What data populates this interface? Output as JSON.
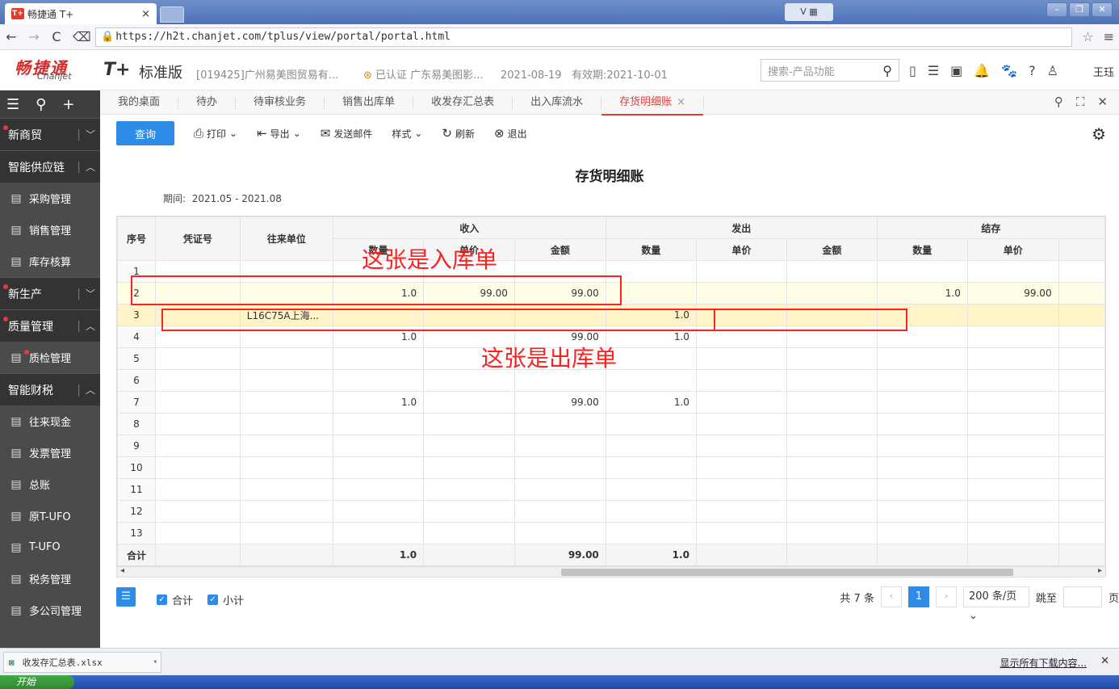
{
  "browser": {
    "tab_title": "畅捷通 T+",
    "tab_logo": "T+",
    "tab_close": "×",
    "url": "https://h2t.chanjet.com/tplus/view/portal/portal.html",
    "win_buttons": [
      "–",
      "❐",
      "✕"
    ]
  },
  "header": {
    "logo_cn": "畅捷通",
    "logo_en": "Chanjet",
    "product": "T+",
    "edition": "标准版",
    "company": "[019425]广州易美图贸易有...",
    "certified": "已认证 广东易美图影...",
    "date": "2021-08-19",
    "validity": "有效期:2021-10-01",
    "search_placeholder": "搜索-产品功能",
    "username": "王珏"
  },
  "sidebar": {
    "groups": [
      {
        "label": "新商贸",
        "arrow": "﹀",
        "dot": true,
        "items": []
      },
      {
        "label": "智能供应链",
        "arrow": "︿",
        "dot": false,
        "items": [
          {
            "label": "采购管理",
            "icon": "cart-icon"
          },
          {
            "label": "销售管理",
            "icon": "chart-icon"
          },
          {
            "label": "库存核算",
            "icon": "warehouse-icon"
          }
        ]
      },
      {
        "label": "新生产",
        "arrow": "﹀",
        "dot": true,
        "items": []
      },
      {
        "label": "质量管理",
        "arrow": "︿",
        "dot": true,
        "items": [
          {
            "label": "质检管理",
            "icon": "shield-icon",
            "dot": true
          }
        ]
      },
      {
        "label": "智能财税",
        "arrow": "︿",
        "dot": false,
        "items": [
          {
            "label": "往来现金",
            "icon": "exchange-icon"
          },
          {
            "label": "发票管理",
            "icon": "invoice-icon"
          },
          {
            "label": "总账",
            "icon": "ledger-icon"
          },
          {
            "label": "原T-UFO",
            "icon": "ufo-icon"
          },
          {
            "label": "T-UFO",
            "icon": "report-icon"
          },
          {
            "label": "税务管理",
            "icon": "tax-icon"
          },
          {
            "label": "多公司管理",
            "icon": "company-icon"
          }
        ]
      }
    ]
  },
  "tabs": {
    "items": [
      "我的桌面",
      "待办",
      "待审核业务",
      "销售出库单",
      "收发存汇总表",
      "出入库流水",
      "存货明细账"
    ],
    "active_index": 6,
    "close": "×"
  },
  "toolbar": {
    "query": "查询",
    "print": "打印",
    "export": "导出",
    "email": "发送邮件",
    "style": "样式",
    "refresh": "刷新",
    "exit": "退出"
  },
  "report": {
    "title": "存货明细账",
    "period_label": "期间:",
    "period_value": "2021.05 - 2021.08",
    "headers": {
      "seq": "序号",
      "voucher": "凭证号",
      "partner": "往来单位",
      "income": "收入",
      "outgo": "发出",
      "balance": "结存",
      "qty": "数量",
      "price": "单价",
      "amount": "金额"
    },
    "rows": [
      {
        "seq": "1",
        "partner": "",
        "in_qty": "",
        "in_price": "",
        "in_amt": "",
        "out_qty": "",
        "out_price": "",
        "out_amt": "",
        "bal_qty": "",
        "bal_price": "",
        "style": ""
      },
      {
        "seq": "2",
        "partner": "",
        "in_qty": "1.0",
        "in_price": "99.00",
        "in_amt": "99.00",
        "out_qty": "",
        "out_price": "",
        "out_amt": "",
        "bal_qty": "1.0",
        "bal_price": "99.00",
        "style": "hl"
      },
      {
        "seq": "3",
        "partner": "L16C75A上海...",
        "in_qty": "",
        "in_price": "",
        "in_amt": "",
        "out_qty": "1.0",
        "out_price": "",
        "out_amt": "",
        "bal_qty": "",
        "bal_price": "",
        "style": "hl2"
      },
      {
        "seq": "4",
        "partner": "",
        "in_qty": "1.0",
        "in_price": "",
        "in_amt": "99.00",
        "out_qty": "1.0",
        "out_price": "",
        "out_amt": "",
        "bal_qty": "",
        "bal_price": "",
        "style": ""
      },
      {
        "seq": "5",
        "partner": "",
        "in_qty": "",
        "in_price": "",
        "in_amt": "",
        "out_qty": "",
        "out_price": "",
        "out_amt": "",
        "bal_qty": "",
        "bal_price": "",
        "style": ""
      },
      {
        "seq": "6",
        "partner": "",
        "in_qty": "",
        "in_price": "",
        "in_amt": "",
        "out_qty": "",
        "out_price": "",
        "out_amt": "",
        "bal_qty": "",
        "bal_price": "",
        "style": ""
      },
      {
        "seq": "7",
        "partner": "",
        "in_qty": "1.0",
        "in_price": "",
        "in_amt": "99.00",
        "out_qty": "1.0",
        "out_price": "",
        "out_amt": "",
        "bal_qty": "",
        "bal_price": "",
        "style": ""
      },
      {
        "seq": "8",
        "partner": "",
        "in_qty": "",
        "in_price": "",
        "in_amt": "",
        "out_qty": "",
        "out_price": "",
        "out_amt": "",
        "bal_qty": "",
        "bal_price": "",
        "style": ""
      },
      {
        "seq": "9",
        "partner": "",
        "in_qty": "",
        "in_price": "",
        "in_amt": "",
        "out_qty": "",
        "out_price": "",
        "out_amt": "",
        "bal_qty": "",
        "bal_price": "",
        "style": ""
      },
      {
        "seq": "10",
        "partner": "",
        "in_qty": "",
        "in_price": "",
        "in_amt": "",
        "out_qty": "",
        "out_price": "",
        "out_amt": "",
        "bal_qty": "",
        "bal_price": "",
        "style": ""
      },
      {
        "seq": "11",
        "partner": "",
        "in_qty": "",
        "in_price": "",
        "in_amt": "",
        "out_qty": "",
        "out_price": "",
        "out_amt": "",
        "bal_qty": "",
        "bal_price": "",
        "style": ""
      },
      {
        "seq": "12",
        "partner": "",
        "in_qty": "",
        "in_price": "",
        "in_amt": "",
        "out_qty": "",
        "out_price": "",
        "out_amt": "",
        "bal_qty": "",
        "bal_price": "",
        "style": ""
      },
      {
        "seq": "13",
        "partner": "",
        "in_qty": "",
        "in_price": "",
        "in_amt": "",
        "out_qty": "",
        "out_price": "",
        "out_amt": "",
        "bal_qty": "",
        "bal_price": "",
        "style": ""
      }
    ],
    "total": {
      "label": "合计",
      "in_qty": "1.0",
      "in_amt": "99.00",
      "out_qty": "1.0"
    }
  },
  "annotations": {
    "inbound": "这张是入库单",
    "outbound": "这张是出库单",
    "color": "#ff2020"
  },
  "footer": {
    "total_chk": "合计",
    "subtotal_chk": "小计",
    "count": "共 7 条",
    "page": "1",
    "page_size": "200 条/页",
    "goto": "跳至",
    "page_unit": "页"
  },
  "downloads": {
    "file": "收发存汇总表.xlsx",
    "show_all": "显示所有下载内容..."
  },
  "taskbar": {
    "start": "开始"
  },
  "colors": {
    "accent": "#2e8be6",
    "active_tab": "#e53a3a",
    "sidebar": "#4b4b4b"
  }
}
